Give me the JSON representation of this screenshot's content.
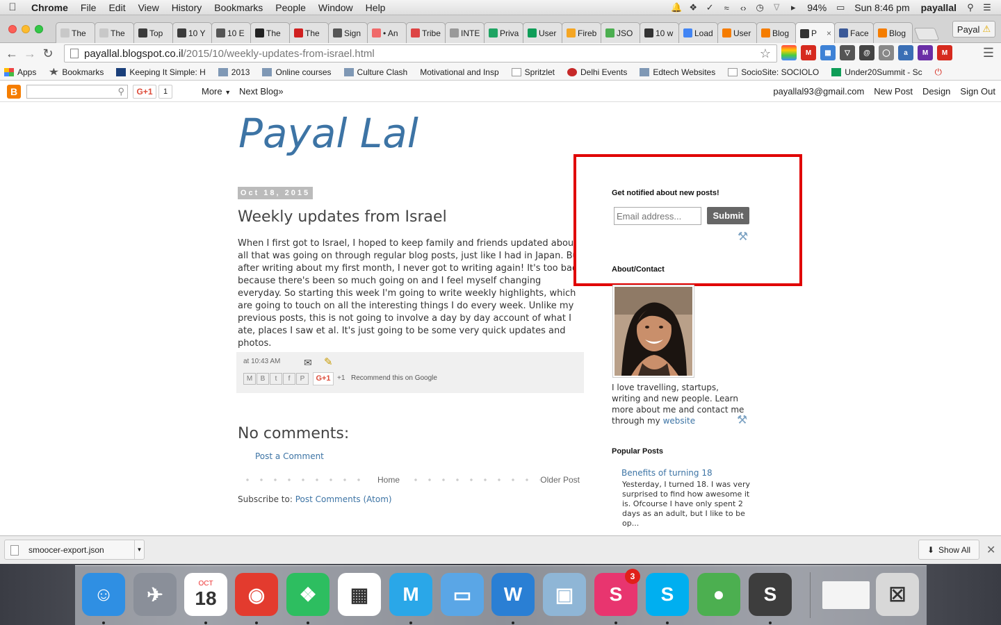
{
  "macmenu": {
    "app": "Chrome",
    "items": [
      "File",
      "Edit",
      "View",
      "History",
      "Bookmarks",
      "People",
      "Window",
      "Help"
    ],
    "battery": "94%",
    "clock": "Sun 8:46 pm",
    "user": "payallal"
  },
  "tabs": [
    {
      "label": "The",
      "icon": "tbs-icon",
      "color": "#c8c8c8"
    },
    {
      "label": "The",
      "icon": "tbs-icon",
      "color": "#c8c8c8"
    },
    {
      "label": "Top",
      "icon": "id-icon",
      "color": "#3b3b3b"
    },
    {
      "label": "10 Y",
      "icon": "id-icon",
      "color": "#3b3b3b"
    },
    {
      "label": "10 E",
      "icon": "quill-icon",
      "color": "#555"
    },
    {
      "label": "The",
      "icon": "r-icon",
      "color": "#222"
    },
    {
      "label": "The",
      "icon": "t-icon",
      "color": "#d02020"
    },
    {
      "label": "Sign",
      "icon": "apple-icon",
      "color": "#555"
    },
    {
      "label": "• An",
      "icon": "asana-icon",
      "color": "#f06a6a"
    },
    {
      "label": "Tribe",
      "icon": "tribe-icon",
      "color": "#d44"
    },
    {
      "label": "INTE",
      "icon": "doc-icon",
      "color": "#999"
    },
    {
      "label": "Priva",
      "icon": "drive-icon",
      "color": "#1fa463"
    },
    {
      "label": "User",
      "icon": "sheets-icon",
      "color": "#0f9d58"
    },
    {
      "label": "Fireb",
      "icon": "firebase-icon",
      "color": "#f5a623"
    },
    {
      "label": "JSO",
      "icon": "json-icon",
      "color": "#4caf50"
    },
    {
      "label": "10 w",
      "icon": "scribble-icon",
      "color": "#333"
    },
    {
      "label": "Load",
      "icon": "chrome-icon",
      "color": "#4285f4"
    },
    {
      "label": "User",
      "icon": "user-icon",
      "color": "#f57c00"
    },
    {
      "label": "Blog",
      "icon": "blogger-icon",
      "color": "#f57d00"
    },
    {
      "label": "P",
      "icon": "pin-icon",
      "color": "#333",
      "active": true
    },
    {
      "label": "Face",
      "icon": "facebook-icon",
      "color": "#3b5998"
    },
    {
      "label": "Blog",
      "icon": "blogger-icon",
      "color": "#f57d00"
    }
  ],
  "profile": "Payal",
  "url": {
    "host": "payallal.blogspot.co.il",
    "path": "/2015/10/weekly-updates-from-israel.html"
  },
  "bookmarks": [
    {
      "label": "Apps",
      "icon": "apps-icon"
    },
    {
      "label": "Bookmarks",
      "icon": "star-icon"
    },
    {
      "label": "Keeping It Simple: H",
      "icon": "d-icon"
    },
    {
      "label": "2013",
      "icon": "folder-icon"
    },
    {
      "label": "Online courses",
      "icon": "folder-icon"
    },
    {
      "label": "Culture Clash",
      "icon": "folder-icon"
    },
    {
      "label": "Motivational and Insp",
      "icon": "none"
    },
    {
      "label": "Spritzlet",
      "icon": "page-icon"
    },
    {
      "label": "Delhi Events",
      "icon": "delhi-icon"
    },
    {
      "label": "Edtech Websites",
      "icon": "folder-icon"
    },
    {
      "label": "SocioSite: SOCIOLO",
      "icon": "page-icon"
    },
    {
      "label": "Under20Summit - Sc",
      "icon": "sheets-icon"
    }
  ],
  "navbar": {
    "gplus": "G+1",
    "gcount": "1",
    "more": "More",
    "next": "Next Blog»",
    "email": "payallal93@gmail.com",
    "new_post": "New Post",
    "design": "Design",
    "sign_out": "Sign Out"
  },
  "blog": {
    "title": "Payal Lal",
    "date": "Oct 18, 2015",
    "post_title": "Weekly updates from Israel",
    "post_body": "When I first got to Israel, I hoped to keep family and friends updated about all that was going on through regular blog posts, just like I had in Japan. But after writing about my first month, I never got to writing again! It's too bad, because there's been so much going on and I feel myself changing everyday. So starting this week I'm going to write weekly highlights, which are going to touch on all the interesting things I do every week. Unlike my previous posts, this is not going to involve a day by day account of what I ate, places I saw et al. It's just going to be some very quick updates and photos.",
    "posted_at_prefix": "at",
    "posted_time": "10:43 AM",
    "gplus": "G+1",
    "plus_one": "+1",
    "recommend": "Recommend this on Google",
    "no_comments": "No comments:",
    "post_a_comment": "Post a Comment",
    "home": "Home",
    "older": "Older Post",
    "subscribe_prefix": "Subscribe to:",
    "subscribe_link": "Post Comments (Atom)"
  },
  "sidebar": {
    "notify_heading": "Get notified about new posts!",
    "email_placeholder": "Email address...",
    "submit": "Submit",
    "about_heading": "About/Contact",
    "about_text": "I love travelling, startups, writing and new people. Learn more about me and contact me through my",
    "about_link": "website",
    "popular_heading": "Popular Posts",
    "popular_title": "Benefits of turning 18",
    "popular_snippet": "Yesterday, I turned 18. I was very  surprised to find how awesome it is. Ofcourse I have only spent 2 days as an adult, but I like to be op..."
  },
  "download": {
    "file": "smoocer-export.json",
    "show_all": "Show All"
  },
  "dock": [
    {
      "name": "finder-icon",
      "color": "#2f8fe3",
      "glyph": "☺"
    },
    {
      "name": "launchpad-icon",
      "color": "#8a8f99",
      "glyph": "✈"
    },
    {
      "name": "calendar-icon",
      "color": "#ffffff",
      "glyph": "18",
      "month": "OCT"
    },
    {
      "name": "chrome-icon",
      "color": "#e33b2e",
      "glyph": "◉"
    },
    {
      "name": "evernote-icon",
      "color": "#2dbe60",
      "glyph": "❖"
    },
    {
      "name": "slack-grid-icon",
      "color": "#ffffff",
      "glyph": "▦"
    },
    {
      "name": "mailbird-icon",
      "color": "#2aa7e8",
      "glyph": "M"
    },
    {
      "name": "keynote-icon",
      "color": "#5aa6e6",
      "glyph": "▭"
    },
    {
      "name": "word-icon",
      "color": "#2a7fd4",
      "glyph": "W"
    },
    {
      "name": "preview-icon",
      "color": "#8fb6d6",
      "glyph": "▣"
    },
    {
      "name": "slack-icon",
      "color": "#e8356f",
      "glyph": "S",
      "badge": "3"
    },
    {
      "name": "skype-icon",
      "color": "#00aff0",
      "glyph": "S"
    },
    {
      "name": "marbles-icon",
      "color": "#4caf50",
      "glyph": "●"
    },
    {
      "name": "sublime-icon",
      "color": "#3d3d3d",
      "glyph": "S"
    },
    {
      "name": "window-thumb-icon",
      "color": "#f4f4f4",
      "glyph": ""
    },
    {
      "name": "trash-icon",
      "color": "#d8d8d8",
      "glyph": "☒"
    }
  ]
}
